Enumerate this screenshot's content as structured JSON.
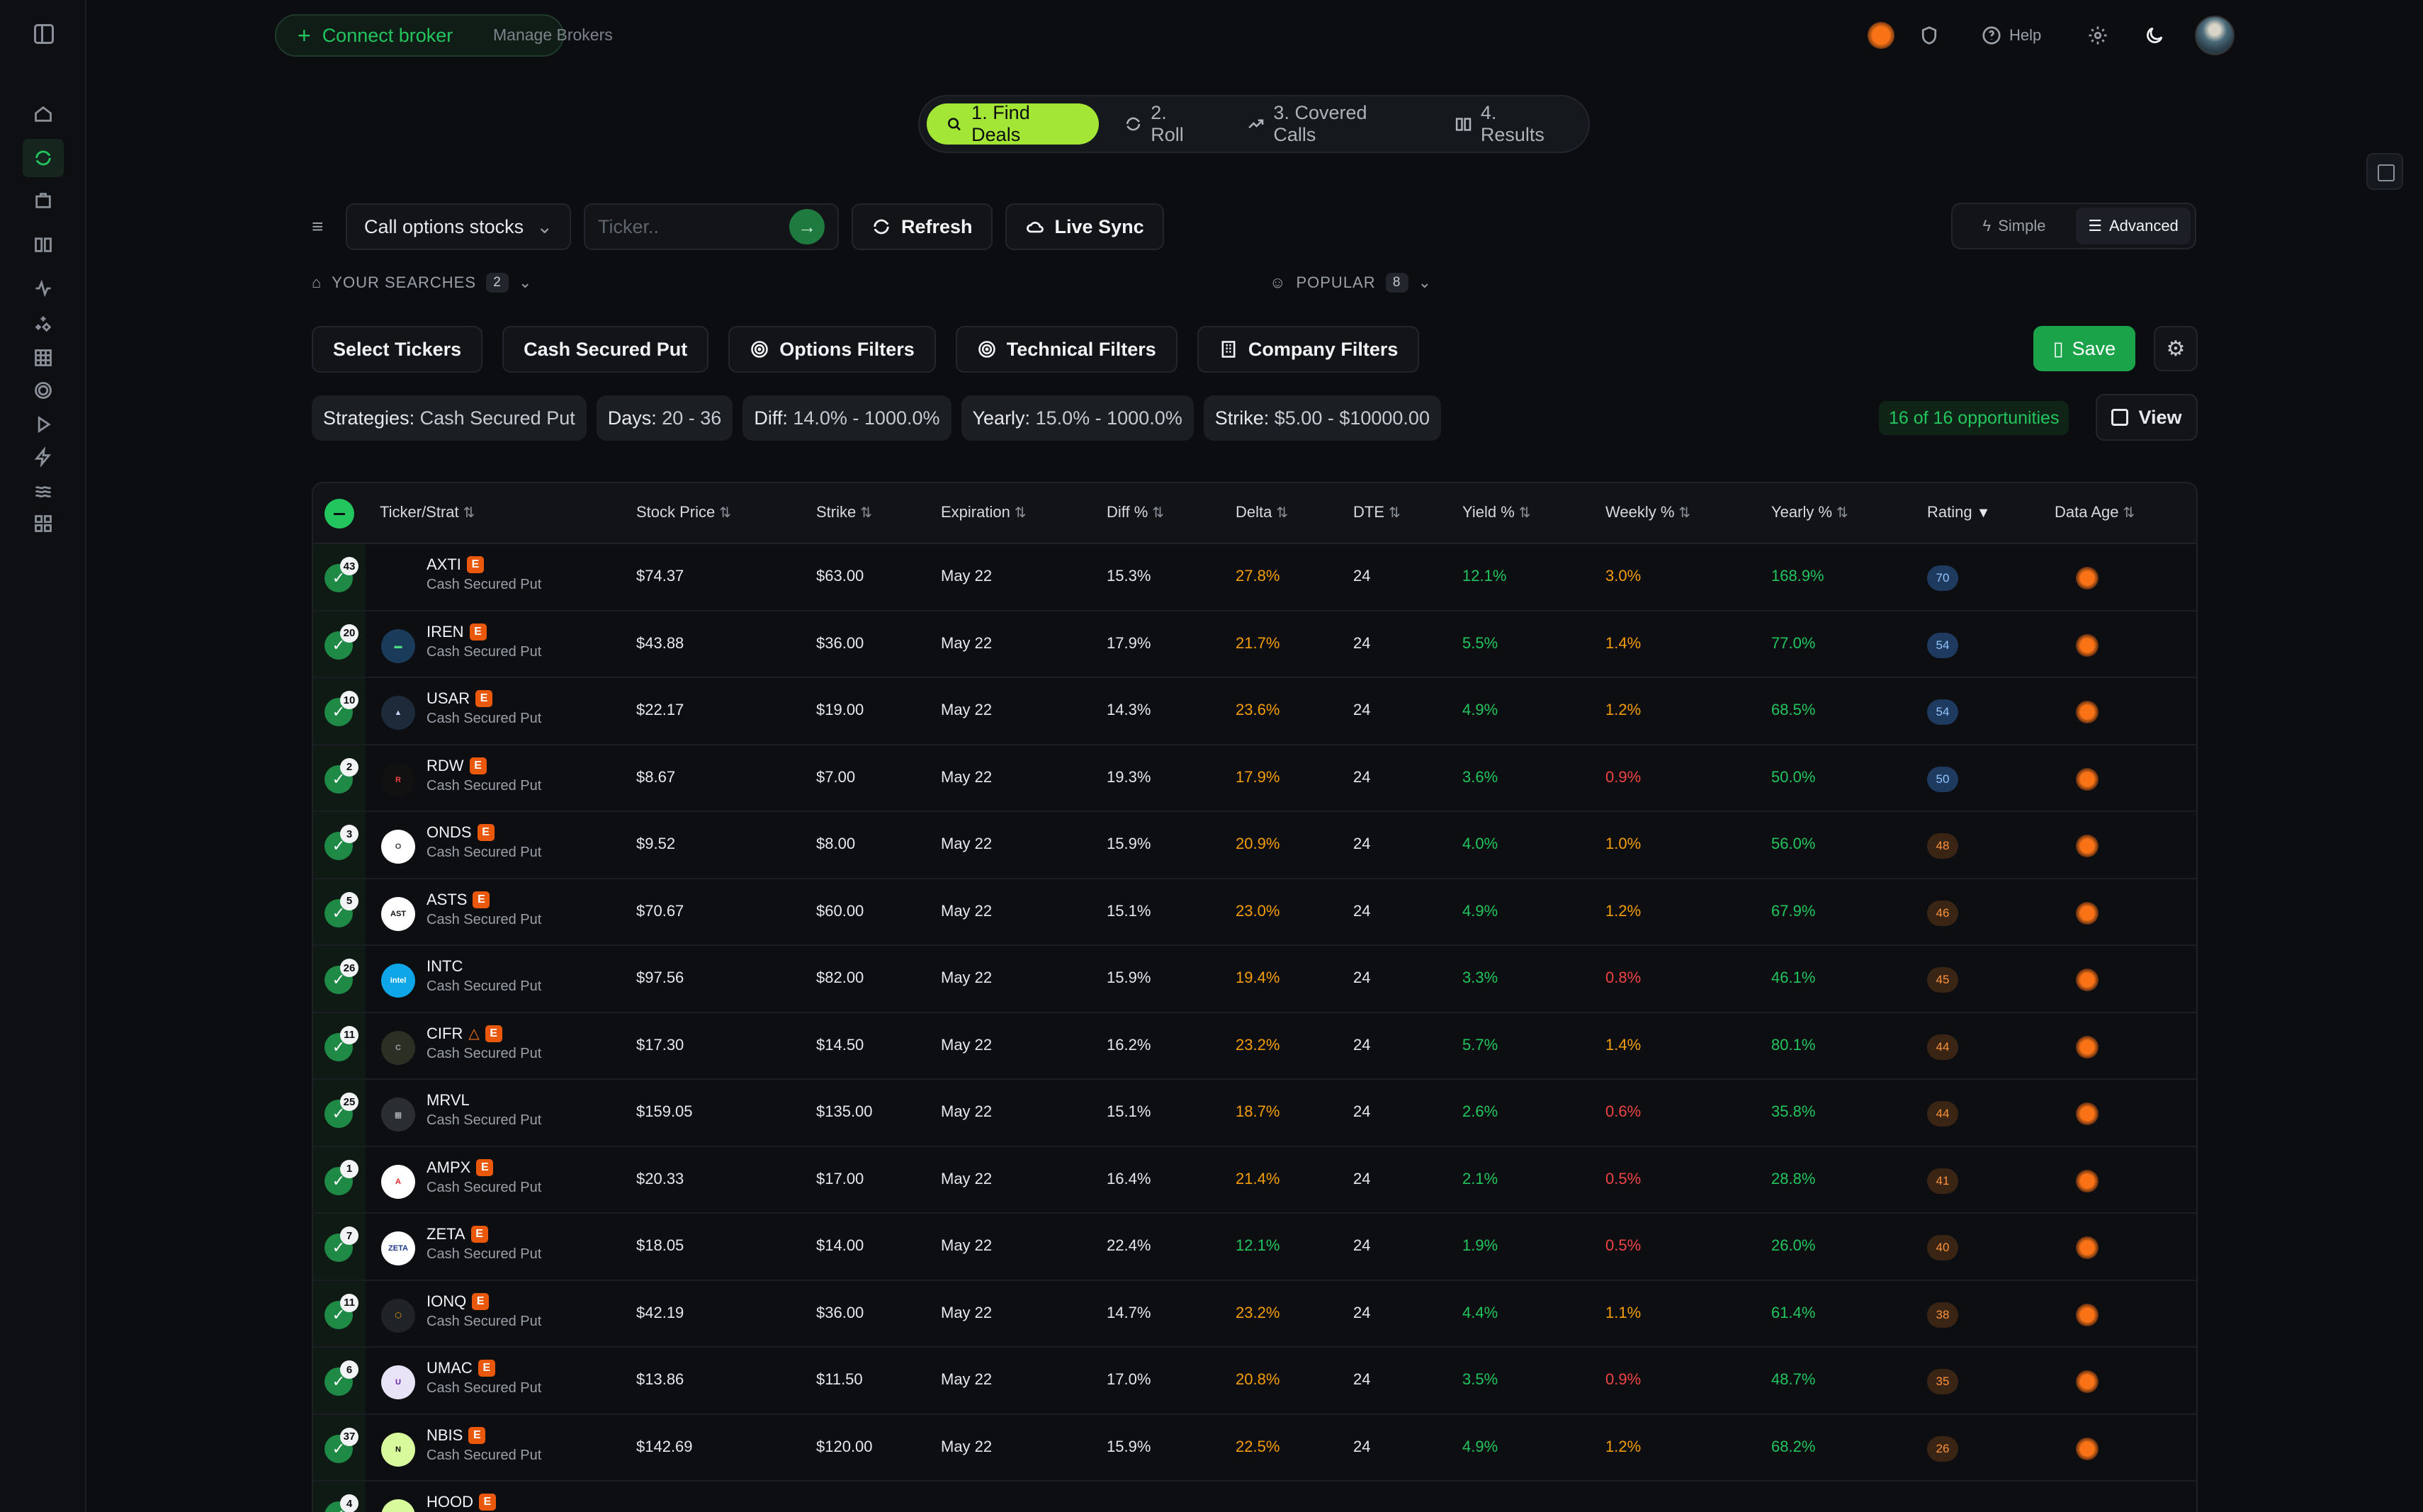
{
  "topbar": {
    "connect_label": "Connect broker",
    "manage_label": "Manage Brokers",
    "help_label": "Help"
  },
  "steps": [
    {
      "label": "1. Find Deals",
      "icon": "search-icon"
    },
    {
      "label": "2. Roll",
      "icon": "refresh-icon"
    },
    {
      "label": "3. Covered Calls",
      "icon": "trending-up-icon"
    },
    {
      "label": "4. Results",
      "icon": "book-icon"
    }
  ],
  "filters": {
    "strategy_select": "Call options stocks",
    "ticker_placeholder": "Ticker..",
    "refresh_label": "Refresh",
    "livesync_label": "Live Sync",
    "mode_simple": "Simple",
    "mode_advanced": "Advanced"
  },
  "searches": {
    "yours_label": "YOUR SEARCHES",
    "yours_count": "2",
    "popular_label": "POPULAR",
    "popular_count": "8"
  },
  "filter_tabs": {
    "select_tickers": "Select Tickers",
    "cash_secured_put": "Cash Secured Put",
    "options_filters": "Options Filters",
    "technical_filters": "Technical Filters",
    "company_filters": "Company Filters",
    "save_label": "Save"
  },
  "chips": [
    {
      "key": "Strategies:",
      "value": "Cash Secured Put"
    },
    {
      "key": "Days:",
      "value": "20 - 36"
    },
    {
      "key": "Diff:",
      "value": "14.0% - 1000.0%"
    },
    {
      "key": "Yearly:",
      "value": "15.0% - 1000.0%"
    },
    {
      "key": "Strike:",
      "value": "$5.00 - $10000.00"
    }
  ],
  "results": {
    "opportunities_label": "16 of 16 opportunities",
    "view_label": "View"
  },
  "table": {
    "headers": {
      "ticker": "Ticker/Strat",
      "price": "Stock Price",
      "strike": "Strike",
      "expiration": "Expiration",
      "diff": "Diff %",
      "delta": "Delta",
      "dte": "DTE",
      "yield": "Yield %",
      "weekly": "Weekly %",
      "yearly": "Yearly %",
      "rating": "Rating",
      "age": "Data Age"
    },
    "rows": [
      {
        "n": "43",
        "ticker": "AXTI",
        "strat": "Cash Secured Put",
        "price": "$74.37",
        "strike": "$63.00",
        "exp": "May 22",
        "diff": "15.3%",
        "delta": "27.8%",
        "dte": "24",
        "yield": "12.1%",
        "weekly": "3.0%",
        "yearly": "168.9%",
        "rating": "70"
      },
      {
        "n": "20",
        "ticker": "IREN",
        "strat": "Cash Secured Put",
        "price": "$43.88",
        "strike": "$36.00",
        "exp": "May 22",
        "diff": "17.9%",
        "delta": "21.7%",
        "dte": "24",
        "yield": "5.5%",
        "weekly": "1.4%",
        "yearly": "77.0%",
        "rating": "54"
      },
      {
        "n": "10",
        "ticker": "USAR",
        "strat": "Cash Secured Put",
        "price": "$22.17",
        "strike": "$19.00",
        "exp": "May 22",
        "diff": "14.3%",
        "delta": "23.6%",
        "dte": "24",
        "yield": "4.9%",
        "weekly": "1.2%",
        "yearly": "68.5%",
        "rating": "54"
      },
      {
        "n": "2",
        "ticker": "RDW",
        "strat": "Cash Secured Put",
        "price": "$8.67",
        "strike": "$7.00",
        "exp": "May 22",
        "diff": "19.3%",
        "delta": "17.9%",
        "dte": "24",
        "yield": "3.6%",
        "weekly": "0.9%",
        "yearly": "50.0%",
        "rating": "50"
      },
      {
        "n": "3",
        "ticker": "ONDS",
        "strat": "Cash Secured Put",
        "price": "$9.52",
        "strike": "$8.00",
        "exp": "May 22",
        "diff": "15.9%",
        "delta": "20.9%",
        "dte": "24",
        "yield": "4.0%",
        "weekly": "1.0%",
        "yearly": "56.0%",
        "rating": "48"
      },
      {
        "n": "5",
        "ticker": "ASTS",
        "strat": "Cash Secured Put",
        "price": "$70.67",
        "strike": "$60.00",
        "exp": "May 22",
        "diff": "15.1%",
        "delta": "23.0%",
        "dte": "24",
        "yield": "4.9%",
        "weekly": "1.2%",
        "yearly": "67.9%",
        "rating": "46"
      },
      {
        "n": "26",
        "ticker": "INTC",
        "strat": "Cash Secured Put",
        "price": "$97.56",
        "strike": "$82.00",
        "exp": "May 22",
        "diff": "15.9%",
        "delta": "19.4%",
        "dte": "24",
        "yield": "3.3%",
        "weekly": "0.8%",
        "yearly": "46.1%",
        "rating": "45"
      },
      {
        "n": "11",
        "ticker": "CIFR",
        "strat": "Cash Secured Put",
        "price": "$17.30",
        "strike": "$14.50",
        "exp": "May 22",
        "diff": "16.2%",
        "delta": "23.2%",
        "dte": "24",
        "yield": "5.7%",
        "weekly": "1.4%",
        "yearly": "80.1%",
        "rating": "44"
      },
      {
        "n": "25",
        "ticker": "MRVL",
        "strat": "Cash Secured Put",
        "price": "$159.05",
        "strike": "$135.00",
        "exp": "May 22",
        "diff": "15.1%",
        "delta": "18.7%",
        "dte": "24",
        "yield": "2.6%",
        "weekly": "0.6%",
        "yearly": "35.8%",
        "rating": "44"
      },
      {
        "n": "1",
        "ticker": "AMPX",
        "strat": "Cash Secured Put",
        "price": "$20.33",
        "strike": "$17.00",
        "exp": "May 22",
        "diff": "16.4%",
        "delta": "21.4%",
        "dte": "24",
        "yield": "2.1%",
        "weekly": "0.5%",
        "yearly": "28.8%",
        "rating": "41"
      },
      {
        "n": "7",
        "ticker": "ZETA",
        "strat": "Cash Secured Put",
        "price": "$18.05",
        "strike": "$14.00",
        "exp": "May 22",
        "diff": "22.4%",
        "delta": "12.1%",
        "dte": "24",
        "yield": "1.9%",
        "weekly": "0.5%",
        "yearly": "26.0%",
        "rating": "40"
      },
      {
        "n": "11",
        "ticker": "IONQ",
        "strat": "Cash Secured Put",
        "price": "$42.19",
        "strike": "$36.00",
        "exp": "May 22",
        "diff": "14.7%",
        "delta": "23.2%",
        "dte": "24",
        "yield": "4.4%",
        "weekly": "1.1%",
        "yearly": "61.4%",
        "rating": "38"
      },
      {
        "n": "6",
        "ticker": "UMAC",
        "strat": "Cash Secured Put",
        "price": "$13.86",
        "strike": "$11.50",
        "exp": "May 22",
        "diff": "17.0%",
        "delta": "20.8%",
        "dte": "24",
        "yield": "3.5%",
        "weekly": "0.9%",
        "yearly": "48.7%",
        "rating": "35"
      },
      {
        "n": "37",
        "ticker": "NBIS",
        "strat": "Cash Secured Put",
        "price": "$142.69",
        "strike": "$120.00",
        "exp": "May 22",
        "diff": "15.9%",
        "delta": "22.5%",
        "dte": "24",
        "yield": "4.9%",
        "weekly": "1.2%",
        "yearly": "68.2%",
        "rating": "26"
      },
      {
        "n": "4",
        "ticker": "HOOD",
        "strat": "",
        "price": "",
        "strike": "",
        "exp": "",
        "diff": "",
        "delta": "",
        "dte": "",
        "yield": "",
        "weekly": "",
        "yearly": "",
        "rating": ""
      }
    ]
  },
  "colors": {
    "accent": "#22c55e",
    "step_active": "#a3e635",
    "earnings_badge": "#ea580c",
    "delta_orange": "#f59e0b",
    "weekly_red": "#ef4444"
  }
}
